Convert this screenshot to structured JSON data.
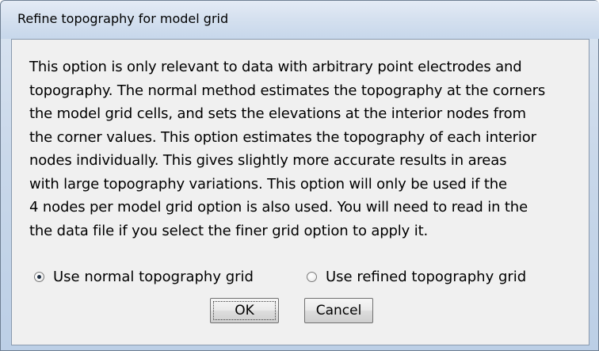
{
  "window": {
    "title": "Refine topography for model grid"
  },
  "description_lines": [
    "This option is only relevant to data with arbitrary point electrodes and",
    "topography. The normal method estimates the topography at the corners",
    "the model grid cells, and sets the elevations at the interior nodes from",
    "the corner values. This option estimates the topography of each interior",
    "nodes individually. This gives slightly more accurate results in areas",
    "with large topography variations. This option will only be used if the",
    "4 nodes per model grid option is also used. You will need to read in the",
    "the data file if you select the finer grid option to apply it."
  ],
  "options": {
    "normal": {
      "label": "Use normal topography grid",
      "selected": true
    },
    "refined": {
      "label": "Use refined topography grid",
      "selected": false
    }
  },
  "buttons": {
    "ok": "OK",
    "cancel": "Cancel"
  }
}
